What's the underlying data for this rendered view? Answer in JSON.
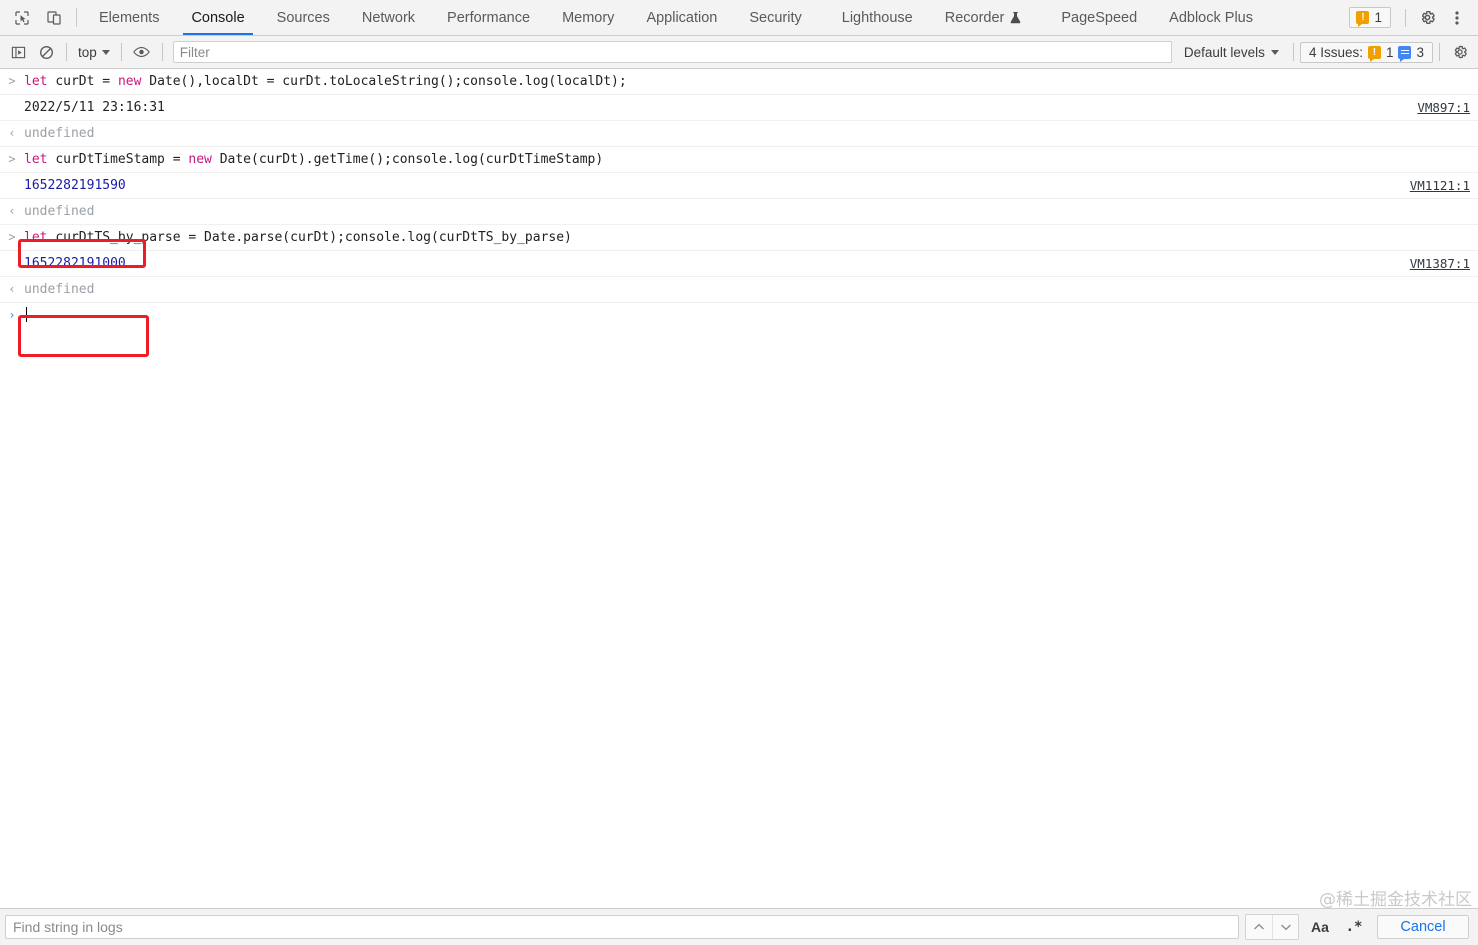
{
  "devtools": {
    "left_icons": [
      {
        "name": "inspect-element-icon",
        "label": "Inspect element"
      },
      {
        "name": "device-toolbar-icon",
        "label": "Toggle device toolbar"
      }
    ],
    "tabs": [
      {
        "id": "elements",
        "label": "Elements",
        "active": false,
        "experimental": false
      },
      {
        "id": "console",
        "label": "Console",
        "active": true,
        "experimental": false
      },
      {
        "id": "sources",
        "label": "Sources",
        "active": false,
        "experimental": false
      },
      {
        "id": "network",
        "label": "Network",
        "active": false,
        "experimental": false
      },
      {
        "id": "performance",
        "label": "Performance",
        "active": false,
        "experimental": false
      },
      {
        "id": "memory",
        "label": "Memory",
        "active": false,
        "experimental": false
      },
      {
        "id": "application",
        "label": "Application",
        "active": false,
        "experimental": false
      },
      {
        "id": "security",
        "label": "Security",
        "active": false,
        "experimental": false
      },
      {
        "id": "lighthouse",
        "label": "Lighthouse",
        "active": false,
        "experimental": false
      },
      {
        "id": "recorder",
        "label": "Recorder",
        "active": false,
        "experimental": true
      },
      {
        "id": "pagespeed",
        "label": "PageSpeed",
        "active": false,
        "experimental": false
      },
      {
        "id": "adblockplus",
        "label": "Adblock Plus",
        "active": false,
        "experimental": false
      }
    ],
    "tabbar_right": {
      "issue_badge_count": "1",
      "settings_label": "Settings",
      "more_label": "More options"
    },
    "accent_color": "#1a73e8",
    "warning_color": "#f0a000",
    "info_color": "#4285f4",
    "annotation_color": "#ee1c25"
  },
  "filterbar": {
    "sidebar_toggle_label": "Show console sidebar",
    "clear_label": "Clear console",
    "context": "top",
    "eye_label": "Create live expression",
    "filter_placeholder": "Filter",
    "filter_value": "",
    "levels_label": "Default levels",
    "issues_label": "4 Issues:",
    "issues_warning_count": "1",
    "issues_info_count": "3",
    "settings_label": "Console settings"
  },
  "console": {
    "rows": [
      {
        "kind": "input",
        "arrow": ">",
        "tokens": [
          {
            "t": "kw",
            "v": "let "
          },
          {
            "t": "plain",
            "v": "curDt = "
          },
          {
            "t": "kw",
            "v": "new "
          },
          {
            "t": "plain",
            "v": "Date(),localDt = curDt.toLocaleString();console.log(localDt);"
          }
        ],
        "text": "let curDt = new Date(),localDt = curDt.toLocaleString();console.log(localDt);",
        "vmlink": ""
      },
      {
        "kind": "log",
        "arrow": "",
        "tokens": [
          {
            "t": "logtxt",
            "v": "2022/5/11 23:16:31"
          }
        ],
        "text": "2022/5/11 23:16:31",
        "vmlink": "VM897:1"
      },
      {
        "kind": "result",
        "arrow": "‹",
        "tokens": [
          {
            "t": "undef",
            "v": "undefined"
          }
        ],
        "text": "undefined",
        "vmlink": ""
      },
      {
        "kind": "input",
        "arrow": ">",
        "tokens": [
          {
            "t": "kw",
            "v": "let "
          },
          {
            "t": "plain",
            "v": "curDtTimeStamp = "
          },
          {
            "t": "kw",
            "v": "new "
          },
          {
            "t": "plain",
            "v": "Date(curDt).getTime();console.log(curDtTimeStamp)"
          }
        ],
        "text": "let curDtTimeStamp = new Date(curDt).getTime();console.log(curDtTimeStamp)",
        "vmlink": ""
      },
      {
        "kind": "log",
        "arrow": "",
        "tokens": [
          {
            "t": "num",
            "v": "1652282191590"
          }
        ],
        "text": "1652282191590",
        "vmlink": "VM1121:1"
      },
      {
        "kind": "result",
        "arrow": "‹",
        "tokens": [
          {
            "t": "undef",
            "v": "undefined"
          }
        ],
        "text": "undefined",
        "vmlink": ""
      },
      {
        "kind": "input",
        "arrow": ">",
        "tokens": [
          {
            "t": "kw",
            "v": "let "
          },
          {
            "t": "plain",
            "v": "curDtTS_by_parse = Date.parse(curDt);console.log(curDtTS_by_parse)"
          }
        ],
        "text": "let curDtTS_by_parse = Date.parse(curDt);console.log(curDtTS_by_parse)",
        "vmlink": ""
      },
      {
        "kind": "log",
        "arrow": "",
        "tokens": [
          {
            "t": "num",
            "v": "1652282191000"
          }
        ],
        "text": "1652282191000",
        "vmlink": "VM1387:1"
      },
      {
        "kind": "result",
        "arrow": "‹",
        "tokens": [
          {
            "t": "undef",
            "v": "undefined"
          }
        ],
        "text": "undefined",
        "vmlink": ""
      }
    ],
    "prompt": {
      "arrow": "›",
      "value": ""
    },
    "annotations": [
      {
        "name": "annotation-box-timestamp-ms",
        "target": "1652282191590"
      },
      {
        "name": "annotation-box-timestamp-parsed",
        "target": "1652282191000"
      }
    ]
  },
  "searchbar": {
    "placeholder": "Find string in logs",
    "value": "",
    "prev_label": "Search previous",
    "next_label": "Search next",
    "match_case_label": "Aa",
    "regex_label": ".*",
    "cancel_label": "Cancel"
  },
  "watermark": "@稀土掘金技术社区"
}
